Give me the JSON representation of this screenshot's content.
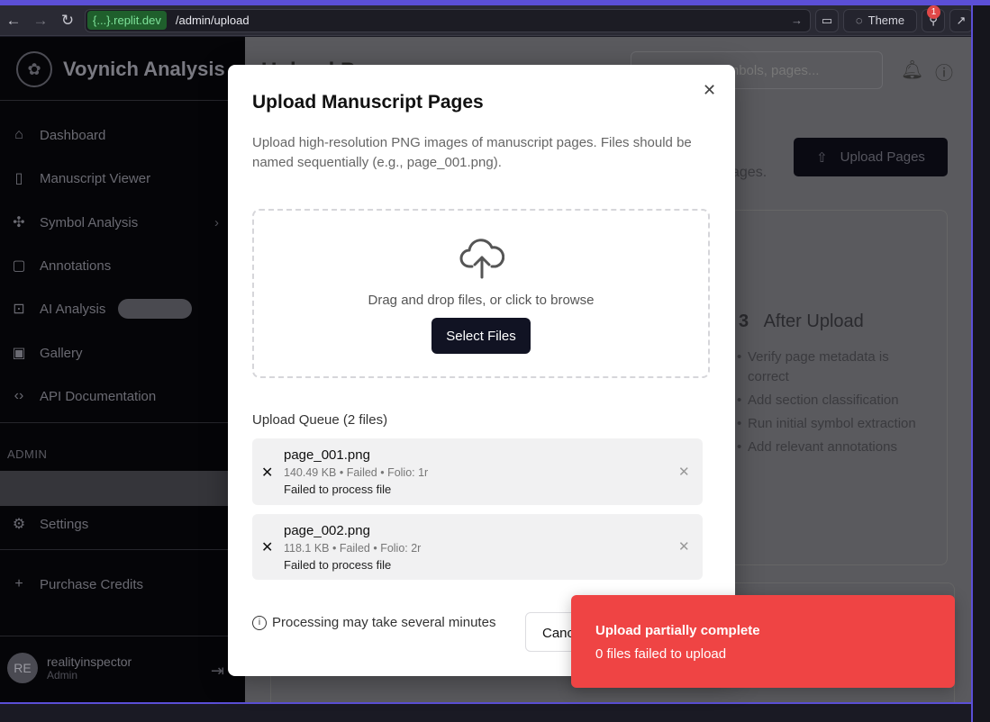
{
  "browser": {
    "url_host": "{...}.replit.dev",
    "url_path": "/admin/upload",
    "theme_label": "Theme",
    "notification_count": "1"
  },
  "sidebar": {
    "app_name": "Voynich Analysis",
    "items": [
      {
        "label": "Dashboard",
        "icon": "home-icon"
      },
      {
        "label": "Manuscript Viewer",
        "icon": "book-icon"
      },
      {
        "label": "Symbol Analysis",
        "icon": "puzzle-icon"
      },
      {
        "label": "Annotations",
        "icon": "message-icon"
      },
      {
        "label": "AI Analysis",
        "icon": "bot-icon"
      },
      {
        "label": "Gallery",
        "icon": "gallery-icon"
      },
      {
        "label": "API Documentation",
        "icon": "code-icon"
      }
    ],
    "admin_section": "ADMIN",
    "settings_label": "Settings",
    "purchase_label": "Purchase Credits",
    "user": {
      "initials": "RE",
      "name": "realityinspector",
      "role": "Admin"
    }
  },
  "header": {
    "title": "Upload P",
    "search_placeholder": "Search symbols, pages..."
  },
  "background": {
    "upload_button": "Upload Pages",
    "subtext": "ages.",
    "after_upload": {
      "number": "3",
      "title": "After Upload",
      "items": [
        "Verify page metadata is correct",
        "Add section classification",
        "Run initial symbol extraction",
        "Add relevant annotations"
      ]
    }
  },
  "modal": {
    "title": "Upload Manuscript Pages",
    "description": "Upload high-resolution PNG images of manuscript pages. Files should be named sequentially (e.g., page_001.png).",
    "dropzone_text": "Drag and drop files, or click to browse",
    "select_button": "Select Files",
    "queue_title": "Upload Queue (2 files)",
    "files": [
      {
        "name": "page_001.png",
        "meta": "140.49 KB • Failed • Folio: 1r",
        "error": "Failed to process file"
      },
      {
        "name": "page_002.png",
        "meta": "118.1 KB • Failed • Folio: 2r",
        "error": "Failed to process file"
      }
    ],
    "footer_note": "Processing may take several minutes",
    "cancel_button": "Canc"
  },
  "toast": {
    "title": "Upload partially complete",
    "message": "0 files failed to upload"
  },
  "colors": {
    "accent": "#5b4fd6",
    "toast_bg": "#ef4444",
    "primary_button": "#111323"
  }
}
